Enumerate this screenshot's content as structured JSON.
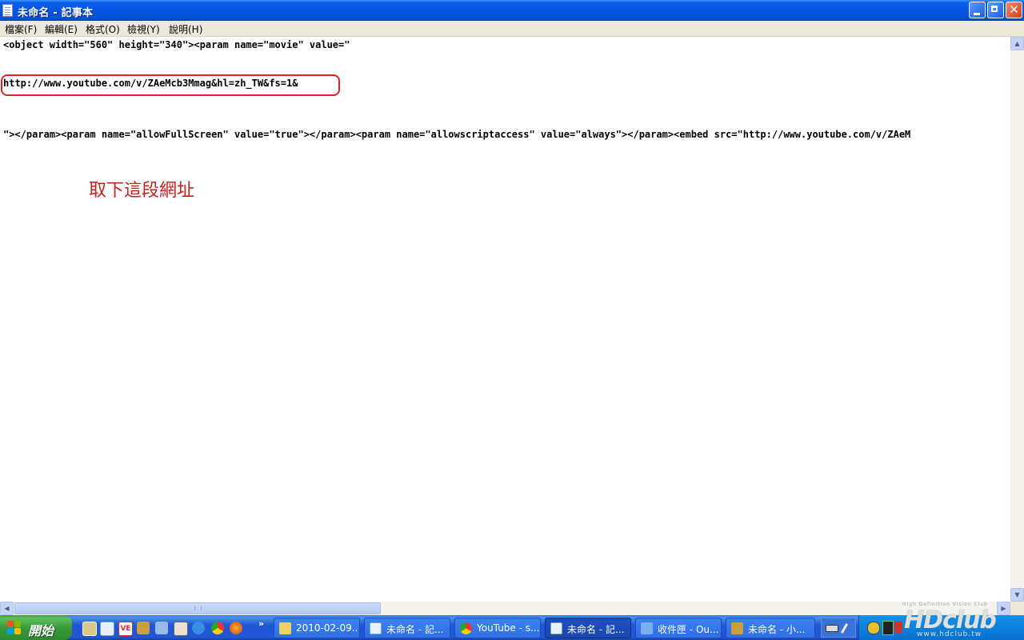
{
  "window": {
    "title": "未命名 - 記事本"
  },
  "menu": {
    "items": [
      "檔案(F)",
      "編輯(E)",
      "格式(O)",
      "檢視(Y)",
      "說明(H)"
    ]
  },
  "document": {
    "line1": "<object width=\"560\" height=\"340\"><param name=\"movie\" value=\"",
    "line2": "http://www.youtube.com/v/ZAeMcb3Mmag&hl=zh_TW&fs=1&",
    "line3": "\"></param><param name=\"allowFullScreen\" value=\"true\"></param><param name=\"allowscriptaccess\" value=\"always\"></param><embed src=\"http://www.youtube.com/v/ZAeM",
    "annotation": "取下這段網址",
    "annotation_color": "#c42020",
    "highlight_color": "#e0221c"
  },
  "taskbar": {
    "start_label": "開始",
    "quick_launch_icons": [
      "show-desktop-icon",
      "notepad-icon",
      "ve-icon",
      "app-icon",
      "network-icon",
      "book-icon",
      "ie-icon",
      "chrome-icon",
      "firefox-icon"
    ],
    "tasks": [
      {
        "label": "2010-02-09...",
        "icon": "folder-icon",
        "active": false
      },
      {
        "label": "未命名 - 記...",
        "icon": "notepad-icon",
        "active": false
      },
      {
        "label": "YouTube - s...",
        "icon": "chrome-icon",
        "active": false
      },
      {
        "label": "未命名 - 記...",
        "icon": "notepad-icon",
        "active": true
      },
      {
        "label": "收件匣 - Ou...",
        "icon": "outlook-icon",
        "active": false
      },
      {
        "label": "未命名 - 小...",
        "icon": "paint-icon",
        "active": false
      }
    ]
  },
  "watermark": {
    "tagline": "High Definition Vision Club",
    "logo": "HDclub",
    "url": "www.hdclub.tw"
  }
}
